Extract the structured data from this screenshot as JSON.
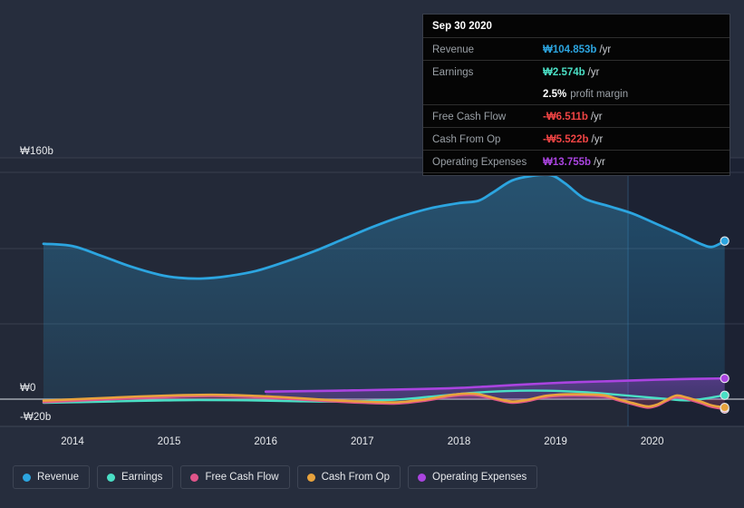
{
  "chart_data": {
    "type": "area",
    "title": "",
    "xlabel": "",
    "ylabel": "",
    "currency": "₩",
    "ylim": [
      -20,
      168
    ],
    "yticks": [
      {
        "label": "₩160b",
        "value": 160
      },
      {
        "label": "₩0",
        "value": 0
      },
      {
        "label": "-₩20b",
        "value": -20
      }
    ],
    "xticks": [
      "2014",
      "2015",
      "2016",
      "2017",
      "2018",
      "2019",
      "2020"
    ],
    "xlim": [
      2013.7,
      2020.8
    ],
    "grid": true,
    "legend_position": "bottom-left",
    "series": [
      {
        "name": "Revenue",
        "color": "#2ca5e0",
        "points": [
          [
            2013.7,
            103.0
          ],
          [
            2014.0,
            101.5
          ],
          [
            2014.3,
            95.0
          ],
          [
            2014.6,
            88.0
          ],
          [
            2014.9,
            82.5
          ],
          [
            2015.1,
            80.5
          ],
          [
            2015.35,
            80.0
          ],
          [
            2015.6,
            81.5
          ],
          [
            2015.9,
            85.0
          ],
          [
            2016.2,
            91.0
          ],
          [
            2016.5,
            98.0
          ],
          [
            2016.8,
            106.0
          ],
          [
            2017.1,
            114.0
          ],
          [
            2017.4,
            121.0
          ],
          [
            2017.7,
            126.5
          ],
          [
            2018.0,
            130.0
          ],
          [
            2018.2,
            131.5
          ],
          [
            2018.35,
            137.0
          ],
          [
            2018.55,
            145.0
          ],
          [
            2018.75,
            148.0
          ],
          [
            2018.95,
            148.5
          ],
          [
            2019.1,
            143.0
          ],
          [
            2019.3,
            133.0
          ],
          [
            2019.55,
            128.0
          ],
          [
            2019.8,
            123.0
          ],
          [
            2020.05,
            116.0
          ],
          [
            2020.3,
            109.0
          ],
          [
            2020.5,
            103.0
          ],
          [
            2020.62,
            101.0
          ],
          [
            2020.75,
            104.853
          ]
        ]
      },
      {
        "name": "Operating Expenses",
        "color": "#aa44e0",
        "points": [
          [
            2016.0,
            5.0
          ],
          [
            2016.4,
            5.3
          ],
          [
            2016.9,
            5.8
          ],
          [
            2017.4,
            6.4
          ],
          [
            2017.9,
            7.2
          ],
          [
            2018.3,
            8.4
          ],
          [
            2018.7,
            9.8
          ],
          [
            2019.1,
            11.0
          ],
          [
            2019.5,
            11.8
          ],
          [
            2019.9,
            12.6
          ],
          [
            2020.3,
            13.3
          ],
          [
            2020.75,
            13.755
          ]
        ]
      },
      {
        "name": "Earnings",
        "color": "#4adfc5",
        "points": [
          [
            2013.7,
            -2.4
          ],
          [
            2014.1,
            -2.0
          ],
          [
            2014.5,
            -1.4
          ],
          [
            2014.9,
            -0.9
          ],
          [
            2015.3,
            -0.6
          ],
          [
            2015.8,
            -0.8
          ],
          [
            2016.3,
            -1.4
          ],
          [
            2016.8,
            -1.6
          ],
          [
            2017.3,
            -0.5
          ],
          [
            2017.7,
            1.6
          ],
          [
            2018.1,
            4.0
          ],
          [
            2018.5,
            5.4
          ],
          [
            2018.9,
            5.6
          ],
          [
            2019.3,
            4.6
          ],
          [
            2019.7,
            2.6
          ],
          [
            2020.1,
            0.4
          ],
          [
            2020.4,
            -0.8
          ],
          [
            2020.75,
            2.574
          ]
        ]
      },
      {
        "name": "Cash From Op",
        "color": "#e8a33d",
        "points": [
          [
            2013.7,
            -1.0
          ],
          [
            2014.2,
            0.4
          ],
          [
            2014.7,
            1.8
          ],
          [
            2015.1,
            2.6
          ],
          [
            2015.45,
            2.9
          ],
          [
            2015.8,
            2.4
          ],
          [
            2016.2,
            1.2
          ],
          [
            2016.6,
            -0.4
          ],
          [
            2017.0,
            -1.6
          ],
          [
            2017.35,
            -2.1
          ],
          [
            2017.65,
            -0.2
          ],
          [
            2017.9,
            2.6
          ],
          [
            2018.05,
            3.6
          ],
          [
            2018.2,
            3.3
          ],
          [
            2018.4,
            0.2
          ],
          [
            2018.55,
            -1.6
          ],
          [
            2018.7,
            -0.6
          ],
          [
            2018.9,
            2.2
          ],
          [
            2019.1,
            3.2
          ],
          [
            2019.3,
            3.2
          ],
          [
            2019.5,
            2.6
          ],
          [
            2019.65,
            0.0
          ],
          [
            2019.8,
            -2.6
          ],
          [
            2019.95,
            -4.8
          ],
          [
            2020.05,
            -3.6
          ],
          [
            2020.15,
            -0.4
          ],
          [
            2020.25,
            2.4
          ],
          [
            2020.35,
            1.2
          ],
          [
            2020.5,
            -1.6
          ],
          [
            2020.62,
            -4.2
          ],
          [
            2020.75,
            -5.522
          ]
        ]
      },
      {
        "name": "Free Cash Flow",
        "color": "#e0558a",
        "points": [
          [
            2013.7,
            -2.0
          ],
          [
            2014.2,
            -0.6
          ],
          [
            2014.7,
            0.8
          ],
          [
            2015.1,
            1.7
          ],
          [
            2015.45,
            2.1
          ],
          [
            2015.8,
            1.6
          ],
          [
            2016.2,
            0.4
          ],
          [
            2016.6,
            -1.2
          ],
          [
            2017.0,
            -2.4
          ],
          [
            2017.35,
            -2.9
          ],
          [
            2017.65,
            -1.0
          ],
          [
            2017.9,
            1.8
          ],
          [
            2018.05,
            2.8
          ],
          [
            2018.2,
            2.5
          ],
          [
            2018.4,
            -0.6
          ],
          [
            2018.55,
            -2.4
          ],
          [
            2018.7,
            -1.4
          ],
          [
            2018.9,
            1.4
          ],
          [
            2019.1,
            2.4
          ],
          [
            2019.3,
            2.4
          ],
          [
            2019.5,
            1.8
          ],
          [
            2019.65,
            -0.8
          ],
          [
            2019.8,
            -3.4
          ],
          [
            2019.95,
            -5.6
          ],
          [
            2020.05,
            -4.4
          ],
          [
            2020.15,
            -1.2
          ],
          [
            2020.25,
            1.4
          ],
          [
            2020.35,
            0.2
          ],
          [
            2020.5,
            -2.6
          ],
          [
            2020.62,
            -5.2
          ],
          [
            2020.75,
            -6.511
          ]
        ]
      }
    ],
    "forecast_divider_x": 2019.75
  },
  "tooltip": {
    "title": "Sep 30 2020",
    "rows": [
      {
        "label": "Revenue",
        "value": "₩104.853b",
        "unit": "/yr",
        "color": "#2ca5e0",
        "sub": ""
      },
      {
        "label": "Earnings",
        "value": "₩2.574b",
        "unit": "/yr",
        "color": "#4adfc5",
        "sub": ""
      },
      {
        "label": "",
        "value": "2.5%",
        "unit": "",
        "color": "#ffffff",
        "sub": "profit margin"
      },
      {
        "label": "Free Cash Flow",
        "value": "-₩6.511b",
        "unit": "/yr",
        "color": "#f04444",
        "sub": ""
      },
      {
        "label": "Cash From Op",
        "value": "-₩5.522b",
        "unit": "/yr",
        "color": "#f04444",
        "sub": ""
      },
      {
        "label": "Operating Expenses",
        "value": "₩13.755b",
        "unit": "/yr",
        "color": "#aa44e0",
        "sub": ""
      }
    ]
  },
  "legend": {
    "items": [
      {
        "label": "Revenue",
        "color": "#2ca5e0"
      },
      {
        "label": "Earnings",
        "color": "#4adfc5"
      },
      {
        "label": "Free Cash Flow",
        "color": "#e0558a"
      },
      {
        "label": "Cash From Op",
        "color": "#e8a33d"
      },
      {
        "label": "Operating Expenses",
        "color": "#aa44e0"
      }
    ]
  },
  "colors": {
    "background": "#262d3d",
    "gridline": "#4a5161",
    "zeroline": "#b9bdc6",
    "tooltip_bg": "#050505",
    "tooltip_border": "#3a3f4b",
    "text": "#e8eaed",
    "muted_text": "#9aa0a6"
  }
}
